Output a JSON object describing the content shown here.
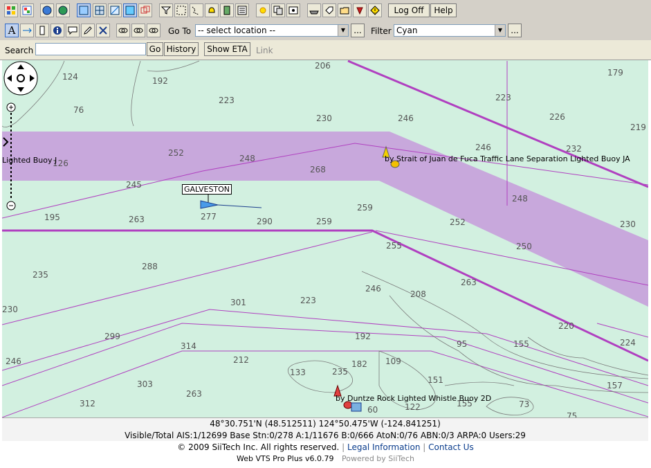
{
  "toolbar": {
    "logoff_label": "Log Off",
    "help_label": "Help"
  },
  "toolbar2": {
    "goto_label": "Go To",
    "goto_value": "-- select location --",
    "filter_label": "Filter",
    "filter_value": "Cyan",
    "more_label": "..."
  },
  "searchbar": {
    "search_label": "Search",
    "go_label": "Go",
    "history_label": "History",
    "show_eta_label": "Show ETA",
    "link_label": "Link"
  },
  "map": {
    "vessel_label": "GALVESTON",
    "buoy_ja_label": "by Strait of Juan de Fuca Traffic Lane Separation Lighted Buoy JA",
    "buoy_2d_label": "by Duntze Rock Lighted Whistle Buoy 2D",
    "buoy_j_label": "Lighted Buoy J",
    "depths": [
      "206",
      "179",
      "124",
      "192",
      "223",
      "226",
      "219",
      "76",
      "230",
      "246",
      "223",
      "232",
      "246",
      "252",
      "248",
      "268",
      "126",
      "245",
      "263",
      "277",
      "290",
      "259",
      "259",
      "252",
      "248",
      "230",
      "195",
      "255",
      "250",
      "235",
      "288",
      "263",
      "301",
      "223",
      "246",
      "208",
      "230",
      "299",
      "192",
      "95",
      "155",
      "220",
      "224",
      "314",
      "212",
      "182",
      "109",
      "246",
      "133",
      "235",
      "151",
      "157",
      "303",
      "263",
      "312",
      "122",
      "155",
      "73",
      "60",
      "75"
    ]
  },
  "status": {
    "coords": "48°30.751'N (48.512511)   124°50.475'W (-124.841251)",
    "counts": "Visible/Total AIS:1/12699  Base Stn:0/278  A:1/11676  B:0/666  AtoN:0/76  ABN:0/3  ARPA:0  Users:29"
  },
  "footer": {
    "copyright": "© 2009 SiiTech Inc. All rights reserved.",
    "legal": "Legal Information",
    "contact": "Contact Us",
    "sep": "|",
    "version": "Web VTS Pro Plus v6.0.79",
    "powered": "Powered by SiiTech"
  }
}
